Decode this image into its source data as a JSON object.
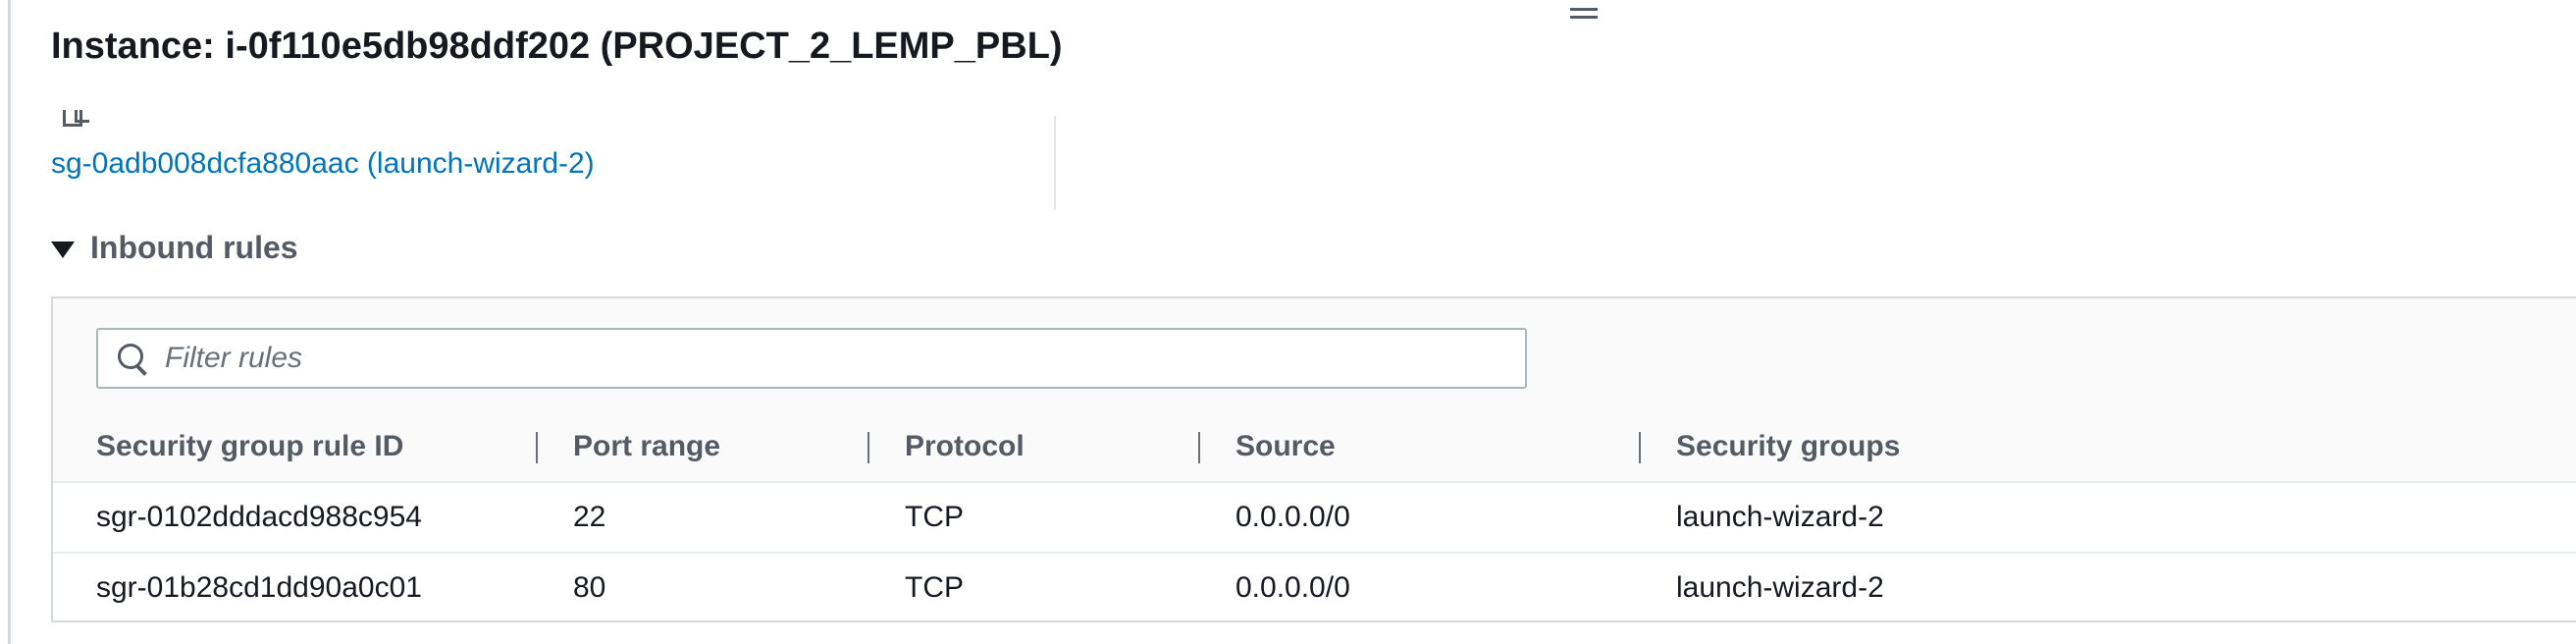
{
  "instance": {
    "title": "Instance: i-0f110e5db98ddf202 (PROJECT_2_LEMP_PBL)"
  },
  "security_group": {
    "link_text": "sg-0adb008dcfa880aac (launch-wizard-2)"
  },
  "inbound_rules": {
    "section_label": "Inbound rules",
    "filter_placeholder": "Filter rules",
    "filter_value": "",
    "columns": [
      "Security group rule ID",
      "Port range",
      "Protocol",
      "Source",
      "Security groups"
    ],
    "rows": [
      {
        "rule_id": "sgr-0102dddacd988c954",
        "port_range": "22",
        "protocol": "TCP",
        "source": "0.0.0.0/0",
        "security_groups": "launch-wizard-2"
      },
      {
        "rule_id": "sgr-01b28cd1dd90a0c01",
        "port_range": "80",
        "protocol": "TCP",
        "source": "0.0.0.0/0",
        "security_groups": "launch-wizard-2"
      }
    ]
  },
  "icons": {
    "copy": "copy-icon",
    "search": "search-icon",
    "caret": "caret-down-icon",
    "drag": "drag-handle-icon"
  },
  "colors": {
    "link": "#0073bb",
    "text": "#16191f",
    "secondary_text": "#545b64",
    "border": "#d5dbdb"
  }
}
